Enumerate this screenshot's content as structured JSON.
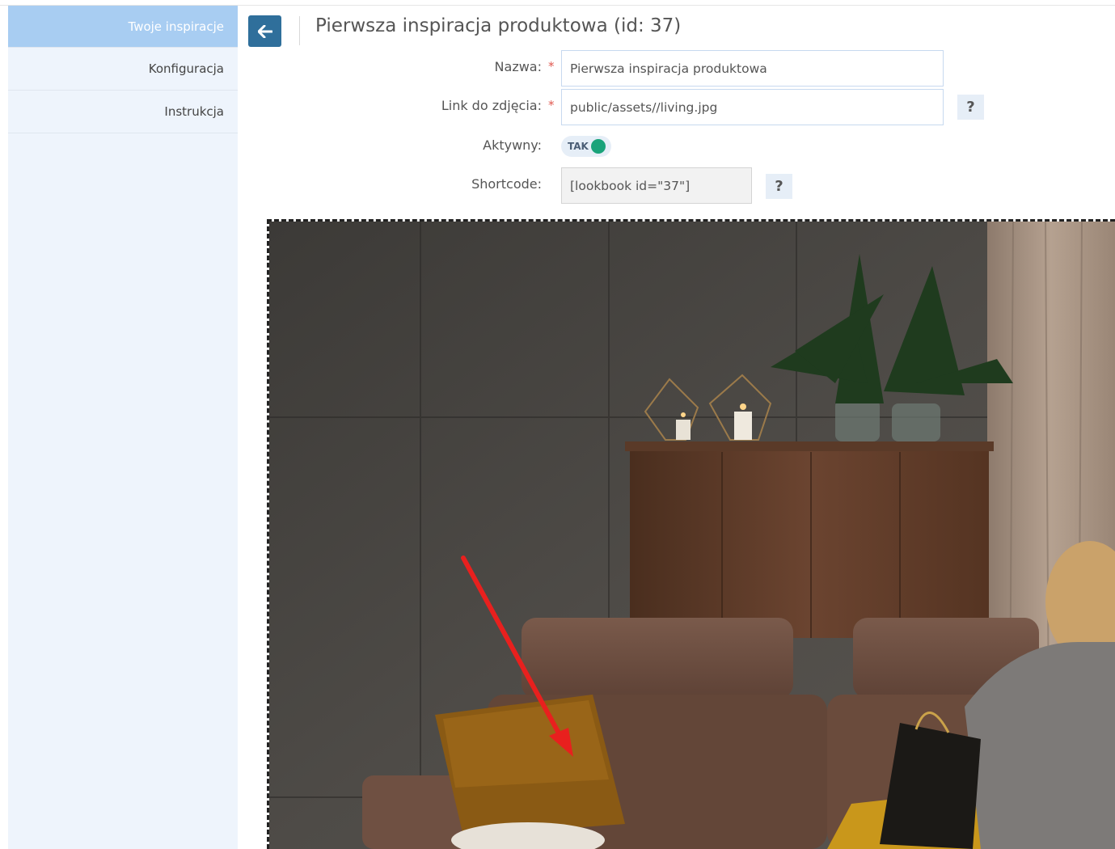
{
  "sidebar": {
    "items": [
      {
        "label": "Twoje inspiracje",
        "active": true
      },
      {
        "label": "Konfiguracja",
        "active": false
      },
      {
        "label": "Instrukcja",
        "active": false
      }
    ]
  },
  "header": {
    "back_icon": "arrow-left-icon",
    "title": "Pierwsza inspiracja produktowa (id: 37)"
  },
  "form": {
    "name": {
      "label": "Nazwa:",
      "required_mark": "*",
      "value": "Pierwsza inspiracja produktowa"
    },
    "image_link": {
      "label": "Link do zdjęcia:",
      "required_mark": "*",
      "value": "public/assets//living.jpg",
      "help": "?"
    },
    "active": {
      "label": "Aktywny:",
      "toggle_text": "TAK",
      "on": true
    },
    "shortcode": {
      "label": "Shortcode:",
      "value": "[lookbook id=\"37\"]",
      "help": "?"
    }
  },
  "colors": {
    "sidebar_bg": "#eef4fc",
    "sidebar_active": "#a8cdf2",
    "back_button": "#2f6f9b",
    "required": "#e0584f",
    "toggle_on": "#1aa37a",
    "annotation_arrow": "#e8201e"
  }
}
